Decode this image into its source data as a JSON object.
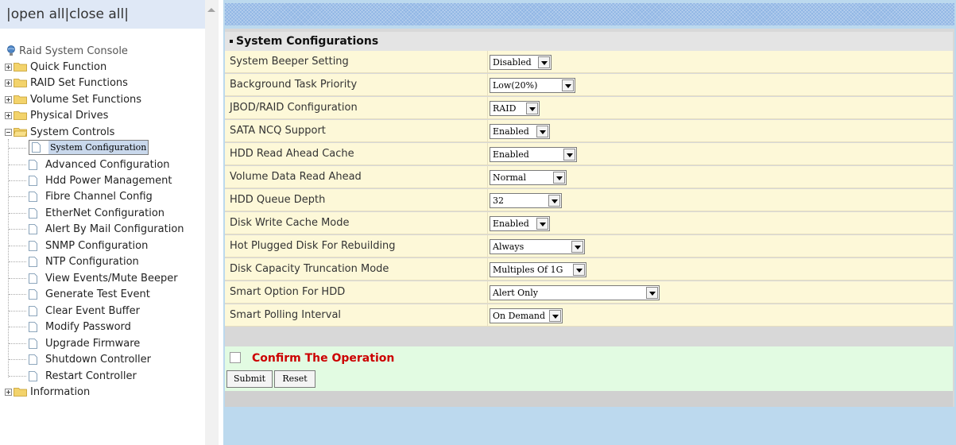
{
  "toggle": {
    "open_all": "open all",
    "close_all": "close all",
    "sep": "|"
  },
  "tree": {
    "root": "Raid System Console",
    "folders": [
      {
        "label": "Quick Function",
        "expanded": false
      },
      {
        "label": "RAID Set Functions",
        "expanded": false
      },
      {
        "label": "Volume Set Functions",
        "expanded": false
      },
      {
        "label": "Physical Drives",
        "expanded": false
      },
      {
        "label": "System Controls",
        "expanded": true
      },
      {
        "label": "Information",
        "expanded": false
      }
    ],
    "system_controls_items": [
      "System Configuration",
      "Advanced Configuration",
      "Hdd Power Management",
      "Fibre Channel Config",
      "EtherNet Configuration",
      "Alert By Mail Configuration",
      "SNMP Configuration",
      "NTP Configuration",
      "View Events/Mute Beeper",
      "Generate Test Event",
      "Clear Event Buffer",
      "Modify Password",
      "Upgrade Firmware",
      "Shutdown Controller",
      "Restart Controller"
    ],
    "selected_item": "System Configuration"
  },
  "section": {
    "title": "System Configurations"
  },
  "settings": [
    {
      "label": "System Beeper Setting",
      "value": "Disabled"
    },
    {
      "label": "Background Task Priority",
      "value": "Low(20%)"
    },
    {
      "label": "JBOD/RAID Configuration",
      "value": "RAID"
    },
    {
      "label": "SATA NCQ Support",
      "value": "Enabled"
    },
    {
      "label": "HDD Read Ahead Cache",
      "value": "Enabled"
    },
    {
      "label": "Volume Data Read Ahead",
      "value": "Normal"
    },
    {
      "label": "HDD Queue Depth",
      "value": "32"
    },
    {
      "label": "Disk Write Cache Mode",
      "value": "Enabled"
    },
    {
      "label": "Hot Plugged Disk For Rebuilding",
      "value": "Always"
    },
    {
      "label": "Disk Capacity Truncation Mode",
      "value": "Multiples Of 1G"
    },
    {
      "label": "Smart Option For HDD",
      "value": "Alert Only"
    },
    {
      "label": "Smart Polling Interval",
      "value": "On Demand"
    }
  ],
  "confirm": {
    "label": "Confirm The Operation",
    "checked": false
  },
  "buttons": {
    "submit": "Submit",
    "reset": "Reset"
  },
  "colors": {
    "row_bg": "#fdf8d8",
    "confirm_bg": "#e2fbe2",
    "confirm_text": "#cc0000",
    "frame_bg": "#bcd9ee",
    "selected_bg": "#c9d8ec"
  }
}
